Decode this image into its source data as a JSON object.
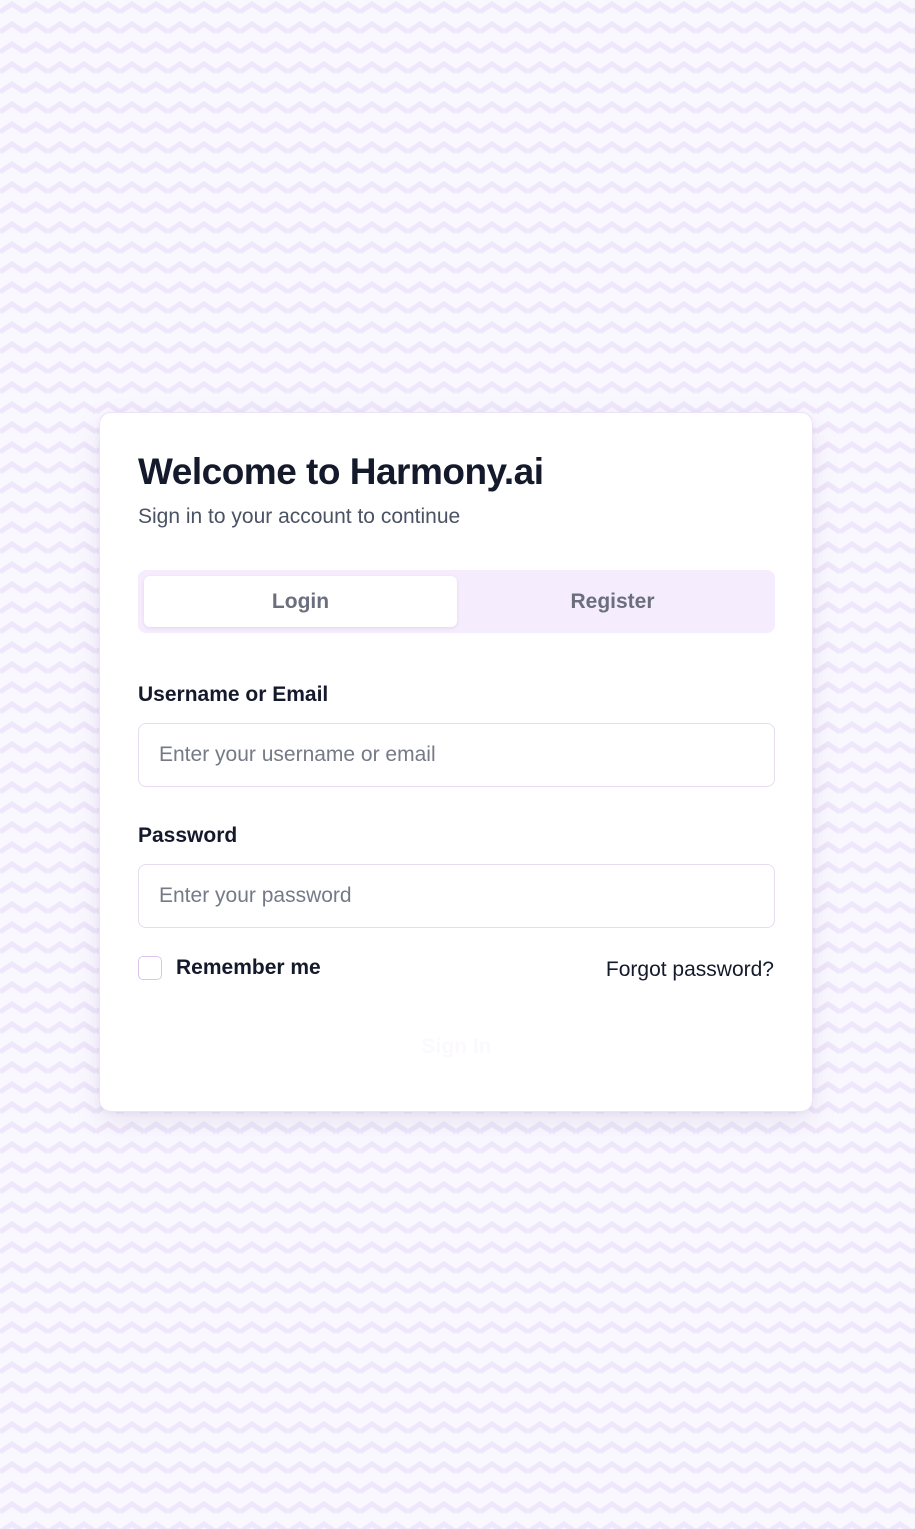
{
  "header": {
    "title": "Welcome to Harmony.ai",
    "subtitle": "Sign in to your account to continue"
  },
  "tabs": [
    {
      "label": "Login",
      "active": true
    },
    {
      "label": "Register",
      "active": false
    }
  ],
  "form": {
    "username": {
      "label": "Username or Email",
      "placeholder": "Enter your username or email",
      "value": ""
    },
    "password": {
      "label": "Password",
      "placeholder": "Enter your password",
      "value": ""
    },
    "remember_label": "Remember me",
    "remember_checked": false,
    "forgot_label": "Forgot password?",
    "submit_label": "Sign In"
  },
  "colors": {
    "background": "#faf8ff",
    "pattern_stroke": "#efe7fb",
    "tab_track": "#f5ecfd",
    "text_primary": "#141a2b",
    "text_secondary": "#4a5264",
    "placeholder": "#757a87"
  }
}
